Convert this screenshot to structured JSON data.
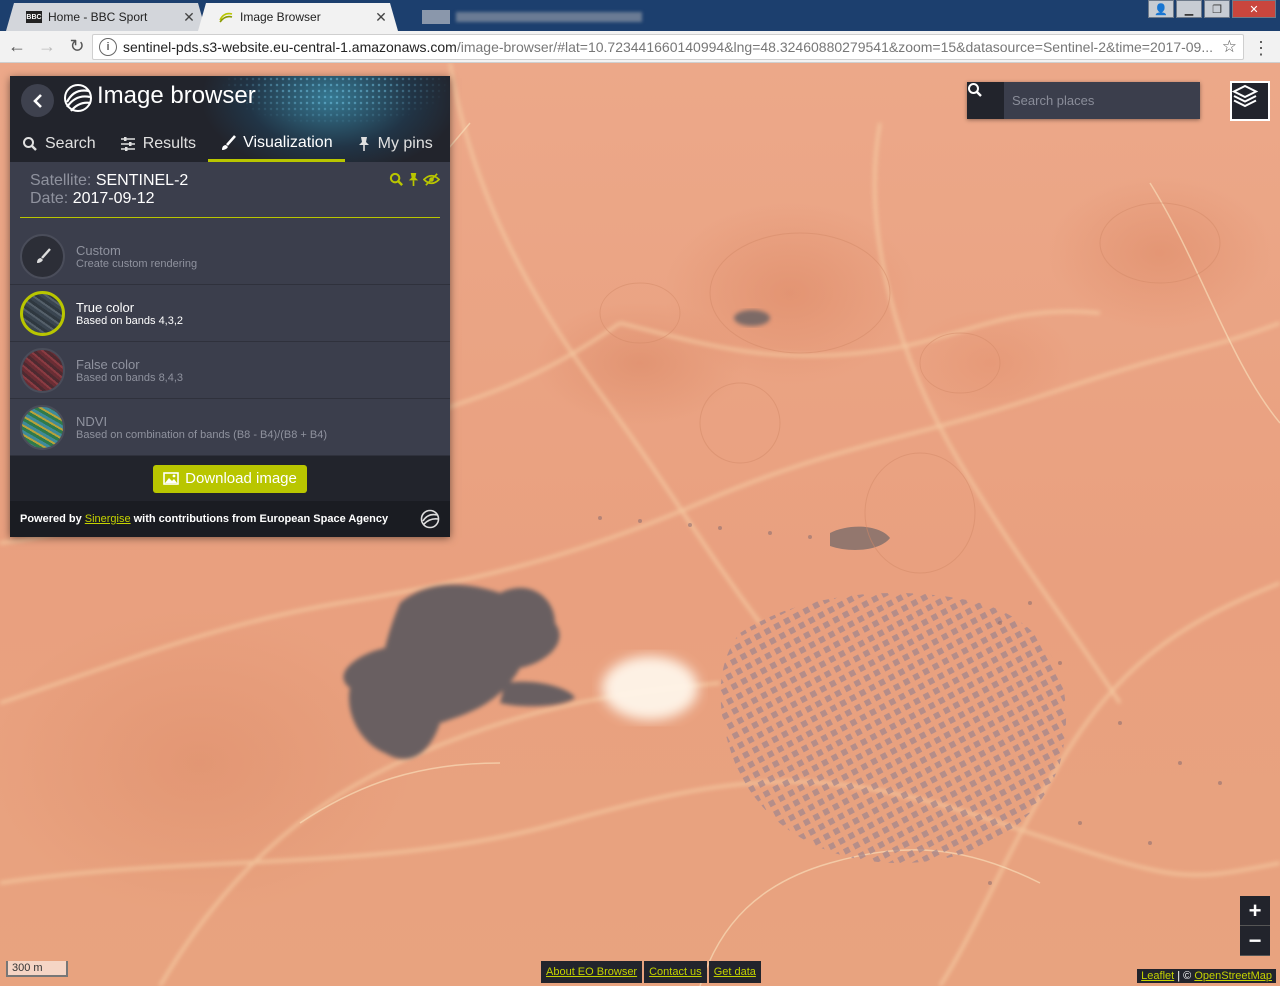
{
  "browser": {
    "tabs": [
      {
        "label": "Home - BBC Sport",
        "favicon": "BBC",
        "active": false
      },
      {
        "label": "Image Browser",
        "favicon": "sentinel-hub-icon",
        "active": true
      },
      {
        "label": "",
        "favicon": "",
        "active": false,
        "blurred": true
      }
    ],
    "url_host": "sentinel-pds.s3-website.eu-central-1.amazonaws.com",
    "url_path": "/image-browser/#lat=10.723441660140994&lng=48.32460880279541&zoom=15&datasource=Sentinel-2&time=2017-09..."
  },
  "panel": {
    "title": "Image browser",
    "tabs": [
      {
        "label": "Search",
        "icon": "search-icon"
      },
      {
        "label": "Results",
        "icon": "sliders-icon"
      },
      {
        "label": "Visualization",
        "icon": "brush-icon",
        "active": true
      },
      {
        "label": "My pins",
        "icon": "pin-icon"
      }
    ],
    "satellite_label": "Satellite:",
    "satellite_value": "SENTINEL-2",
    "date_label": "Date:",
    "date_value": "2017-09-12",
    "visualizations": [
      {
        "title": "Custom",
        "subtitle": "Create custom rendering",
        "selected": false
      },
      {
        "title": "True color",
        "subtitle": "Based on bands 4,3,2",
        "selected": true
      },
      {
        "title": "False color",
        "subtitle": "Based on bands 8,4,3",
        "selected": false
      },
      {
        "title": "NDVI",
        "subtitle": "Based on combination of bands (B8 - B4)/(B8 + B4)",
        "selected": false
      }
    ],
    "download_label": "Download image",
    "powered_prefix": "Powered by",
    "powered_link": "Sinergise",
    "powered_suffix": "with contributions from European Space Agency"
  },
  "map": {
    "search_placeholder": "Search places",
    "scale_label": "300 m",
    "links": [
      "About EO Browser",
      "Contact us",
      "Get data"
    ],
    "attribution_leaflet": "Leaflet",
    "attribution_sep": " | © ",
    "attribution_osm": "OpenStreetMap",
    "zoom_in": "+",
    "zoom_out": "−"
  },
  "colors": {
    "accent": "#b9c600",
    "panel_bg": "#3b3e4c",
    "panel_dark": "#22242c",
    "desert": "#e9a07f"
  }
}
